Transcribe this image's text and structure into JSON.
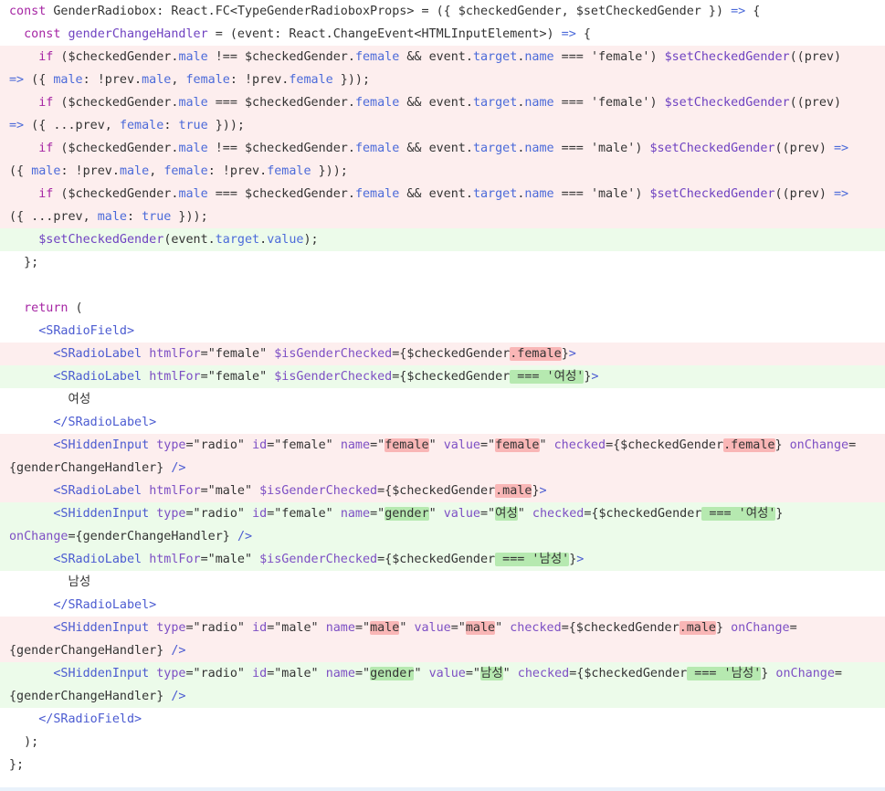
{
  "colors": {
    "text": "#333333",
    "keyword": "#a626a4",
    "purple": "#6f42c1",
    "blue": "#4a59c8",
    "prop": "#4b6ad9",
    "tag": "#4b5bd1",
    "attr": "#7d4fc4",
    "string": "#24292e",
    "del_bg": "#fdeeee",
    "add_bg": "#ecfbea",
    "del_hl": "#f9b6b6",
    "add_hl": "#b6e9b0"
  },
  "lines": [
    {
      "type": "ctx",
      "tokens": [
        [
          "const ",
          "keyword"
        ],
        [
          "GenderRadiobox",
          ""
        ],
        [
          ": React.FC<",
          ""
        ],
        [
          "TypeGenderRadioboxProps",
          ""
        ],
        [
          "> = ({ $checkedGender, $setCheckedGender }) ",
          ""
        ],
        [
          "=>",
          "prop"
        ],
        [
          " {",
          ""
        ]
      ]
    },
    {
      "type": "ctx",
      "tokens": [
        [
          "  const ",
          "keyword"
        ],
        [
          "genderChangeHandler",
          "purple"
        ],
        [
          " = ",
          ""
        ],
        [
          "(event: React.ChangeEvent<HTMLInputElement>) ",
          ""
        ],
        [
          "=>",
          "prop"
        ],
        [
          " {",
          ""
        ]
      ]
    },
    {
      "type": "del",
      "tokens": [
        [
          "    ",
          ""
        ],
        [
          "if",
          "keyword"
        ],
        [
          " ($checkedGender.",
          ""
        ],
        [
          "male",
          "prop"
        ],
        [
          " !== ",
          ""
        ],
        [
          "$checkedGender.",
          ""
        ],
        [
          "female",
          "prop"
        ],
        [
          " && ",
          ""
        ],
        [
          "event.",
          ""
        ],
        [
          "target",
          "prop"
        ],
        [
          ".",
          ""
        ],
        [
          "name",
          "prop"
        ],
        [
          " === ",
          ""
        ],
        [
          "'female'",
          ""
        ],
        [
          ") ",
          ""
        ],
        [
          "$setCheckedGender",
          "purple"
        ],
        [
          "((prev)",
          ""
        ]
      ]
    },
    {
      "type": "del",
      "tokens": [
        [
          "=>",
          "prop"
        ],
        [
          " ({ ",
          ""
        ],
        [
          "male",
          "prop"
        ],
        [
          ": !prev.",
          ""
        ],
        [
          "male",
          "prop"
        ],
        [
          ", ",
          ""
        ],
        [
          "female",
          "prop"
        ],
        [
          ": !prev.",
          ""
        ],
        [
          "female",
          "prop"
        ],
        [
          " }));",
          ""
        ]
      ]
    },
    {
      "type": "del",
      "tokens": [
        [
          "    ",
          ""
        ],
        [
          "if",
          "keyword"
        ],
        [
          " ($checkedGender.",
          ""
        ],
        [
          "male",
          "prop"
        ],
        [
          " === ",
          ""
        ],
        [
          "$checkedGender.",
          ""
        ],
        [
          "female",
          "prop"
        ],
        [
          " && ",
          ""
        ],
        [
          "event.",
          ""
        ],
        [
          "target",
          "prop"
        ],
        [
          ".",
          ""
        ],
        [
          "name",
          "prop"
        ],
        [
          " === ",
          ""
        ],
        [
          "'female'",
          ""
        ],
        [
          ") ",
          ""
        ],
        [
          "$setCheckedGender",
          "purple"
        ],
        [
          "((prev)",
          ""
        ]
      ]
    },
    {
      "type": "del",
      "tokens": [
        [
          "=>",
          "prop"
        ],
        [
          " ({ ...prev, ",
          ""
        ],
        [
          "female",
          "prop"
        ],
        [
          ": ",
          ""
        ],
        [
          "true",
          "prop"
        ],
        [
          " }));",
          ""
        ]
      ]
    },
    {
      "type": "del",
      "tokens": [
        [
          "    ",
          ""
        ],
        [
          "if",
          "keyword"
        ],
        [
          " ($checkedGender.",
          ""
        ],
        [
          "male",
          "prop"
        ],
        [
          " !== ",
          ""
        ],
        [
          "$checkedGender.",
          ""
        ],
        [
          "female",
          "prop"
        ],
        [
          " && ",
          ""
        ],
        [
          "event.",
          ""
        ],
        [
          "target",
          "prop"
        ],
        [
          ".",
          ""
        ],
        [
          "name",
          "prop"
        ],
        [
          " === ",
          ""
        ],
        [
          "'male'",
          ""
        ],
        [
          ") ",
          ""
        ],
        [
          "$setCheckedGender",
          "purple"
        ],
        [
          "((prev) ",
          ""
        ],
        [
          "=>",
          "prop"
        ]
      ]
    },
    {
      "type": "del",
      "tokens": [
        [
          "({ ",
          ""
        ],
        [
          "male",
          "prop"
        ],
        [
          ": !prev.",
          ""
        ],
        [
          "male",
          "prop"
        ],
        [
          ", ",
          ""
        ],
        [
          "female",
          "prop"
        ],
        [
          ": !prev.",
          ""
        ],
        [
          "female",
          "prop"
        ],
        [
          " }));",
          ""
        ]
      ]
    },
    {
      "type": "del",
      "tokens": [
        [
          "    ",
          ""
        ],
        [
          "if",
          "keyword"
        ],
        [
          " ($checkedGender.",
          ""
        ],
        [
          "male",
          "prop"
        ],
        [
          " === ",
          ""
        ],
        [
          "$checkedGender.",
          ""
        ],
        [
          "female",
          "prop"
        ],
        [
          " && ",
          ""
        ],
        [
          "event.",
          ""
        ],
        [
          "target",
          "prop"
        ],
        [
          ".",
          ""
        ],
        [
          "name",
          "prop"
        ],
        [
          " === ",
          ""
        ],
        [
          "'male'",
          ""
        ],
        [
          ") ",
          ""
        ],
        [
          "$setCheckedGender",
          "purple"
        ],
        [
          "((prev) ",
          ""
        ],
        [
          "=>",
          "prop"
        ]
      ]
    },
    {
      "type": "del",
      "tokens": [
        [
          "({ ...prev, ",
          ""
        ],
        [
          "male",
          "prop"
        ],
        [
          ": ",
          ""
        ],
        [
          "true",
          "prop"
        ],
        [
          " }));",
          ""
        ]
      ]
    },
    {
      "type": "add",
      "tokens": [
        [
          "    ",
          ""
        ],
        [
          "$setCheckedGender",
          "purple"
        ],
        [
          "(event.",
          ""
        ],
        [
          "target",
          "prop"
        ],
        [
          ".",
          ""
        ],
        [
          "value",
          "prop"
        ],
        [
          ");",
          ""
        ]
      ]
    },
    {
      "type": "ctx",
      "tokens": [
        [
          "  };",
          ""
        ]
      ]
    },
    {
      "type": "ctx",
      "tokens": [
        [
          "",
          ""
        ]
      ]
    },
    {
      "type": "ctx",
      "tokens": [
        [
          "  ",
          ""
        ],
        [
          "return",
          "keyword"
        ],
        [
          " (",
          ""
        ]
      ]
    },
    {
      "type": "ctx",
      "tokens": [
        [
          "    ",
          ""
        ],
        [
          "<SRadioField>",
          "tag"
        ]
      ]
    },
    {
      "type": "del",
      "tokens": [
        [
          "      ",
          ""
        ],
        [
          "<SRadioLabel",
          "tag"
        ],
        [
          " ",
          ""
        ],
        [
          "htmlFor",
          "attr"
        ],
        [
          "=",
          ""
        ],
        [
          "\"female\"",
          ""
        ],
        [
          " ",
          ""
        ],
        [
          "$isGenderChecked",
          "attr"
        ],
        [
          "={$checkedGender",
          ""
        ],
        [
          ".female",
          "hl"
        ],
        [
          "}",
          ""
        ],
        [
          ">",
          "tag"
        ]
      ]
    },
    {
      "type": "add",
      "tokens": [
        [
          "      ",
          ""
        ],
        [
          "<SRadioLabel",
          "tag"
        ],
        [
          " ",
          ""
        ],
        [
          "htmlFor",
          "attr"
        ],
        [
          "=",
          ""
        ],
        [
          "\"female\"",
          ""
        ],
        [
          " ",
          ""
        ],
        [
          "$isGenderChecked",
          "attr"
        ],
        [
          "={$checkedGender",
          ""
        ],
        [
          " === '여성'",
          "hl"
        ],
        [
          "}",
          ""
        ],
        [
          ">",
          "tag"
        ]
      ]
    },
    {
      "type": "ctx",
      "tokens": [
        [
          "        여성",
          ""
        ]
      ]
    },
    {
      "type": "ctx",
      "tokens": [
        [
          "      ",
          ""
        ],
        [
          "</SRadioLabel>",
          "tag"
        ]
      ]
    },
    {
      "type": "del",
      "tokens": [
        [
          "      ",
          ""
        ],
        [
          "<SHiddenInput",
          "tag"
        ],
        [
          " ",
          ""
        ],
        [
          "type",
          "attr"
        ],
        [
          "=\"radio\" ",
          ""
        ],
        [
          "id",
          "attr"
        ],
        [
          "=\"female\" ",
          ""
        ],
        [
          "name",
          "attr"
        ],
        [
          "=\"",
          ""
        ],
        [
          "female",
          "hl"
        ],
        [
          "\" ",
          ""
        ],
        [
          "value",
          "attr"
        ],
        [
          "=\"",
          ""
        ],
        [
          "female",
          "hl"
        ],
        [
          "\" ",
          ""
        ],
        [
          "checked",
          "attr"
        ],
        [
          "={$checkedGender",
          ""
        ],
        [
          ".female",
          "hl"
        ],
        [
          "} ",
          ""
        ],
        [
          "onChange",
          "attr"
        ],
        [
          "=",
          ""
        ]
      ]
    },
    {
      "type": "del",
      "tokens": [
        [
          "{genderChangeHandler} ",
          ""
        ],
        [
          "/>",
          "tag"
        ]
      ]
    },
    {
      "type": "del",
      "tokens": [
        [
          "      ",
          ""
        ],
        [
          "<SRadioLabel",
          "tag"
        ],
        [
          " ",
          ""
        ],
        [
          "htmlFor",
          "attr"
        ],
        [
          "=\"male\" ",
          ""
        ],
        [
          "$isGenderChecked",
          "attr"
        ],
        [
          "={$checkedGender",
          ""
        ],
        [
          ".male",
          "hl"
        ],
        [
          "}",
          ""
        ],
        [
          ">",
          "tag"
        ]
      ]
    },
    {
      "type": "add",
      "tokens": [
        [
          "      ",
          ""
        ],
        [
          "<SHiddenInput",
          "tag"
        ],
        [
          " ",
          ""
        ],
        [
          "type",
          "attr"
        ],
        [
          "=\"radio\" ",
          ""
        ],
        [
          "id",
          "attr"
        ],
        [
          "=\"female\" ",
          ""
        ],
        [
          "name",
          "attr"
        ],
        [
          "=\"",
          ""
        ],
        [
          "gender",
          "hl"
        ],
        [
          "\" ",
          ""
        ],
        [
          "value",
          "attr"
        ],
        [
          "=\"",
          ""
        ],
        [
          "여성",
          "hl"
        ],
        [
          "\" ",
          ""
        ],
        [
          "checked",
          "attr"
        ],
        [
          "={$checkedGender",
          ""
        ],
        [
          " === '여성'",
          "hl"
        ],
        [
          "}",
          ""
        ]
      ]
    },
    {
      "type": "add",
      "tokens": [
        [
          "onChange",
          "attr"
        ],
        [
          "={genderChangeHandler} ",
          ""
        ],
        [
          "/>",
          "tag"
        ]
      ]
    },
    {
      "type": "add",
      "tokens": [
        [
          "      ",
          ""
        ],
        [
          "<SRadioLabel",
          "tag"
        ],
        [
          " ",
          ""
        ],
        [
          "htmlFor",
          "attr"
        ],
        [
          "=\"male\" ",
          ""
        ],
        [
          "$isGenderChecked",
          "attr"
        ],
        [
          "={$checkedGender",
          ""
        ],
        [
          " === '남성'",
          "hl"
        ],
        [
          "}",
          ""
        ],
        [
          ">",
          "tag"
        ]
      ]
    },
    {
      "type": "ctx",
      "tokens": [
        [
          "        남성",
          ""
        ]
      ]
    },
    {
      "type": "ctx",
      "tokens": [
        [
          "      ",
          ""
        ],
        [
          "</SRadioLabel>",
          "tag"
        ]
      ]
    },
    {
      "type": "del",
      "tokens": [
        [
          "      ",
          ""
        ],
        [
          "<SHiddenInput",
          "tag"
        ],
        [
          " ",
          ""
        ],
        [
          "type",
          "attr"
        ],
        [
          "=\"radio\" ",
          ""
        ],
        [
          "id",
          "attr"
        ],
        [
          "=\"male\" ",
          ""
        ],
        [
          "name",
          "attr"
        ],
        [
          "=\"",
          ""
        ],
        [
          "male",
          "hl"
        ],
        [
          "\" ",
          ""
        ],
        [
          "value",
          "attr"
        ],
        [
          "=\"",
          ""
        ],
        [
          "male",
          "hl"
        ],
        [
          "\" ",
          ""
        ],
        [
          "checked",
          "attr"
        ],
        [
          "={$checkedGender",
          ""
        ],
        [
          ".male",
          "hl"
        ],
        [
          "} ",
          ""
        ],
        [
          "onChange",
          "attr"
        ],
        [
          "=",
          ""
        ]
      ]
    },
    {
      "type": "del",
      "tokens": [
        [
          "{genderChangeHandler} ",
          ""
        ],
        [
          "/>",
          "tag"
        ]
      ]
    },
    {
      "type": "add",
      "tokens": [
        [
          "      ",
          ""
        ],
        [
          "<SHiddenInput",
          "tag"
        ],
        [
          " ",
          ""
        ],
        [
          "type",
          "attr"
        ],
        [
          "=\"radio\" ",
          ""
        ],
        [
          "id",
          "attr"
        ],
        [
          "=\"male\" ",
          ""
        ],
        [
          "name",
          "attr"
        ],
        [
          "=\"",
          ""
        ],
        [
          "gender",
          "hl"
        ],
        [
          "\" ",
          ""
        ],
        [
          "value",
          "attr"
        ],
        [
          "=\"",
          ""
        ],
        [
          "남성",
          "hl"
        ],
        [
          "\" ",
          ""
        ],
        [
          "checked",
          "attr"
        ],
        [
          "={$checkedGender",
          ""
        ],
        [
          " === '남성'",
          "hl"
        ],
        [
          "} ",
          ""
        ],
        [
          "onChange",
          "attr"
        ],
        [
          "=",
          ""
        ]
      ]
    },
    {
      "type": "add",
      "tokens": [
        [
          "{genderChangeHandler} ",
          ""
        ],
        [
          "/>",
          "tag"
        ]
      ]
    },
    {
      "type": "ctx",
      "tokens": [
        [
          "    ",
          ""
        ],
        [
          "</SRadioField>",
          "tag"
        ]
      ]
    },
    {
      "type": "ctx",
      "tokens": [
        [
          "  );",
          ""
        ]
      ]
    },
    {
      "type": "ctx",
      "tokens": [
        [
          "};",
          ""
        ]
      ]
    }
  ]
}
